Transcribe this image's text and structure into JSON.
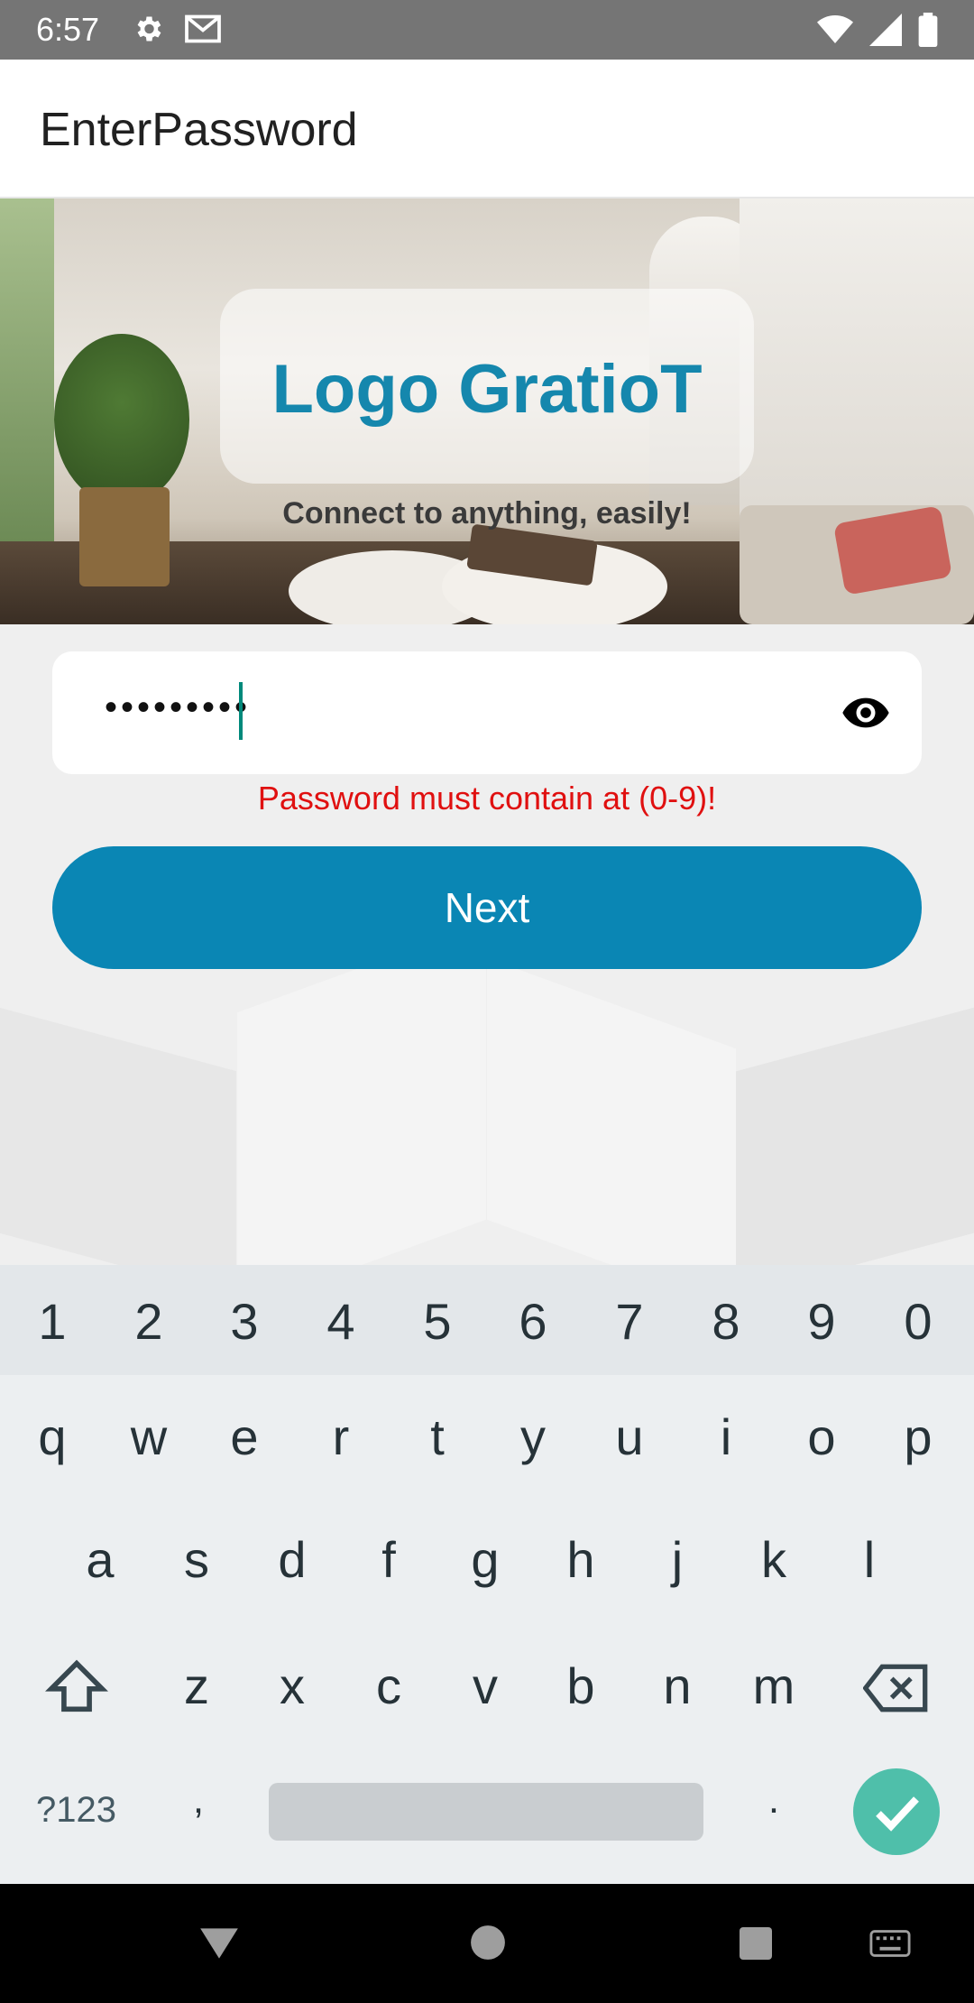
{
  "status_bar": {
    "time": "6:57",
    "icons_left": [
      "settings-icon",
      "gmail-icon"
    ],
    "icons_right": [
      "wifi-icon",
      "signal-icon",
      "battery-icon"
    ]
  },
  "app_bar": {
    "title": "EnterPassword"
  },
  "hero": {
    "logo_text": "Logo GratioT",
    "tagline": "Connect to anything, easily!"
  },
  "form": {
    "password_masked": "•••••••••",
    "visibility_icon": "eye-icon",
    "error_message": "Password must contain at (0-9)!",
    "next_label": "Next"
  },
  "keyboard": {
    "number_row": [
      "1",
      "2",
      "3",
      "4",
      "5",
      "6",
      "7",
      "8",
      "9",
      "0"
    ],
    "row1": [
      "q",
      "w",
      "e",
      "r",
      "t",
      "y",
      "u",
      "i",
      "o",
      "p"
    ],
    "row2": [
      "a",
      "s",
      "d",
      "f",
      "g",
      "h",
      "j",
      "k",
      "l"
    ],
    "row3": [
      "z",
      "x",
      "c",
      "v",
      "b",
      "n",
      "m"
    ],
    "symbols_label": "?123",
    "comma": ",",
    "period": "."
  },
  "colors": {
    "accent": "#0a86b4",
    "logo": "#1587ad",
    "error": "#e01010",
    "caret": "#00897b",
    "enter_key": "#4fbfaa"
  }
}
